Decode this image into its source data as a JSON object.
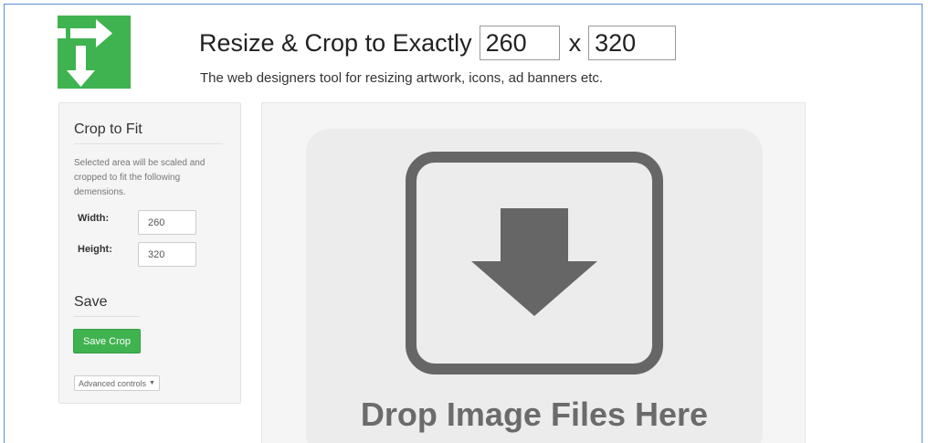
{
  "header": {
    "title_prefix": "Resize & Crop to Exactly",
    "width_value": "260",
    "separator": "x",
    "height_value": "320",
    "subtitle": "The web designers tool for resizing artwork, icons, ad banners etc."
  },
  "logo": {
    "icon": "download-arrow-logo-icon",
    "color": "#3fb34f"
  },
  "sidebar": {
    "crop_title": "Crop to Fit",
    "help_text": "Selected area will be scaled and cropped to fit the following demensions.",
    "width_label": "Width:",
    "width_value": "260",
    "height_label": "Height:",
    "height_value": "320",
    "save_title": "Save",
    "save_button": "Save Crop",
    "advanced_button": "Advanced controls",
    "advanced_caret": "▼"
  },
  "drop_zone": {
    "text": "Drop Image Files Here",
    "icon": "download-arrow-icon"
  },
  "colors": {
    "accent_green": "#3fb34f",
    "drop_icon": "#666666",
    "frame_border": "#5b8fd4"
  }
}
